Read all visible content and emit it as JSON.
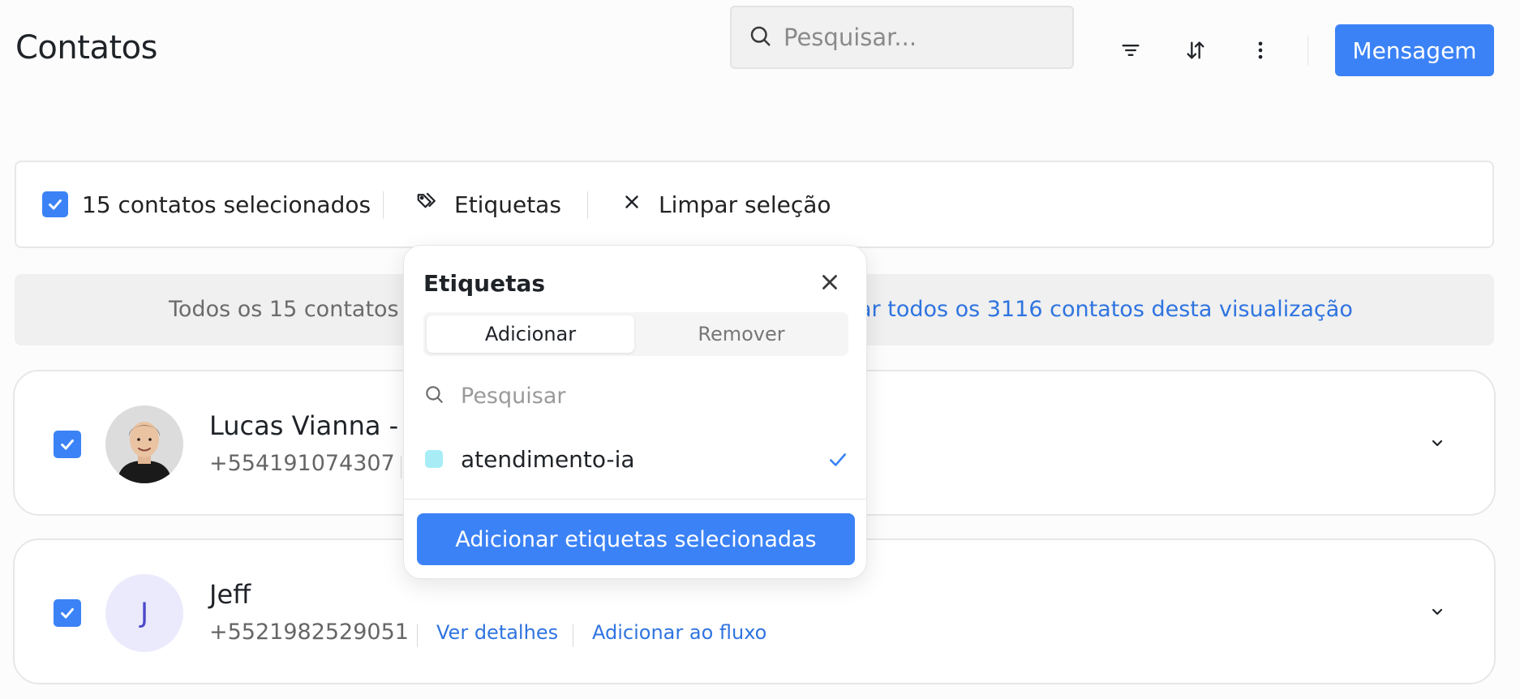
{
  "header": {
    "title": "Contatos",
    "search_placeholder": "Pesquisar...",
    "filter_icon": "filter-icon",
    "sort_icon": "sort-icon",
    "more_icon": "more-vertical-icon",
    "message_button": "Mensagem"
  },
  "selection_bar": {
    "selected_label": "15 contatos selecionados",
    "tags_label": "Etiquetas",
    "clear_label": "Limpar seleção"
  },
  "banner": {
    "text": "Todos os 15 contatos de",
    "link": "ar todos os 3116 contatos desta visualização"
  },
  "contacts": [
    {
      "name": "Lucas Vianna - L",
      "phone": "+554191074307",
      "avatar_type": "photo"
    },
    {
      "name": "Jeff",
      "phone": "+5521982529051",
      "avatar_initial": "J",
      "details_link": "Ver detalhes",
      "flow_link": "Adicionar ao fluxo"
    }
  ],
  "tags_popover": {
    "title": "Etiquetas",
    "tab_add": "Adicionar",
    "tab_remove": "Remover",
    "search_placeholder": "Pesquisar",
    "tags": [
      {
        "label": "atendimento-ia",
        "color": "#a8edf6",
        "selected": true
      }
    ],
    "action_button": "Adicionar etiquetas selecionadas"
  },
  "colors": {
    "accent": "#3b82f6",
    "link": "#2f74e0",
    "avatar_bg": "#ebeafd",
    "avatar_initial": "#4b49c9"
  }
}
